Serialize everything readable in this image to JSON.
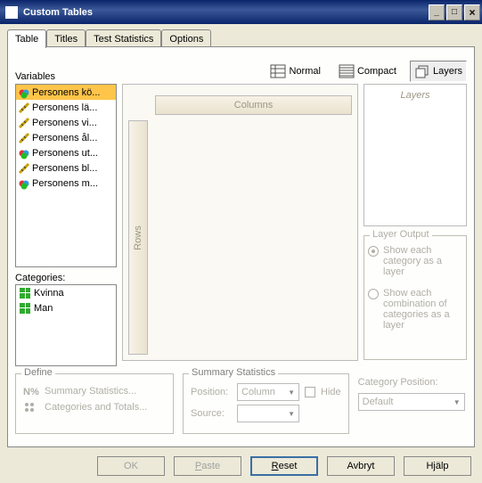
{
  "window": {
    "title": "Custom Tables"
  },
  "tabs": {
    "t0": "Table",
    "t1": "Titles",
    "t2": "Test Statistics",
    "t3": "Options"
  },
  "labels": {
    "variables": "Variables",
    "categories": "Categories:",
    "normal": "Normal",
    "compact": "Compact",
    "layers": "Layers",
    "columns": "Columns",
    "rows": "Rows"
  },
  "vars": {
    "v0": "Personens kö...",
    "v1": "Personens lä...",
    "v2": "Personens vi...",
    "v3": "Personens ål...",
    "v4": "Personens ut...",
    "v5": "Personens bl...",
    "v6": "Personens m..."
  },
  "cats": {
    "c0": "Kvinna",
    "c1": "Man"
  },
  "layersPanel": {
    "header": "Layers"
  },
  "layerOutput": {
    "group": "Layer Output",
    "r0": "Show each category as a layer",
    "r1": "Show each combination of categories as a layer"
  },
  "define": {
    "group": "Define",
    "sumstats": "Summary Statistics...",
    "cattot": "Categories and Totals..."
  },
  "sumgroup": {
    "group": "Summary Statistics",
    "pos": "Position:",
    "posval": "Column",
    "src": "Source:",
    "hide": "Hide"
  },
  "catpos": {
    "label": "Category Position:",
    "value": "Default"
  },
  "buttons": {
    "ok": "OK",
    "paste": "Paste",
    "reset": "Reset",
    "cancel": "Avbryt",
    "help": "Hjälp"
  }
}
